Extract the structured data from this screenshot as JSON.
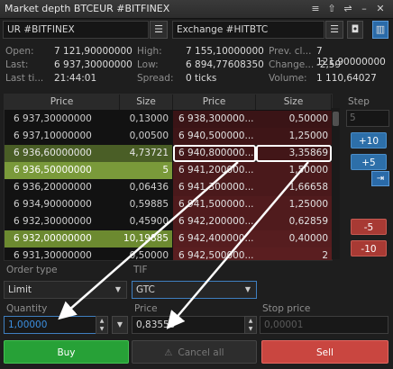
{
  "window": {
    "title": "Market depth BTCEUR  #BITFINEX",
    "buttons": [
      "≡",
      "⇧",
      "⇌",
      "–",
      "✕"
    ]
  },
  "selectors": {
    "left": {
      "value": "UR  #BITFINEX"
    },
    "right": {
      "value": "Exchange  #HITBTC"
    }
  },
  "stats": {
    "open": {
      "label": "Open:",
      "value": "7 121,90000000"
    },
    "high": {
      "label": "High:",
      "value": "7 155,10000000"
    },
    "prev": {
      "label": "Prev. cl...",
      "value": "7 121,90000000"
    },
    "last": {
      "label": "Last:",
      "value": "6 937,30000000"
    },
    "low": {
      "label": "Low:",
      "value": "6 894,77608350"
    },
    "change": {
      "label": "Change...",
      "value": "-2,59"
    },
    "lasttime": {
      "label": "Last ti...",
      "value": "21:44:01"
    },
    "spread": {
      "label": "Spread:",
      "value": "0 ticks"
    },
    "volume": {
      "label": "Volume:",
      "value": "1 110,64027"
    }
  },
  "table": {
    "headers": [
      "Price",
      "Size",
      "Price",
      "Size"
    ],
    "rows": [
      {
        "bid_price": "6 937,30000000",
        "bid_size": "0,13000",
        "ask_price": "6 938,300000...",
        "ask_size": "0,50000"
      },
      {
        "bid_price": "6 937,10000000",
        "bid_size": "0,00500",
        "ask_price": "6 940,500000...",
        "ask_size": "1,25000"
      },
      {
        "bid_price": "6 936,60000000",
        "bid_size": "4,73721",
        "ask_price": "6 940,800000...",
        "ask_size": "3,35869"
      },
      {
        "bid_price": "6 936,50000000",
        "bid_size": "5",
        "ask_price": "6 941,200000...",
        "ask_size": "1,50000"
      },
      {
        "bid_price": "6 936,20000000",
        "bid_size": "0,06436",
        "ask_price": "6 941,300000...",
        "ask_size": "1,66658"
      },
      {
        "bid_price": "6 934,90000000",
        "bid_size": "0,59885",
        "ask_price": "6 941,500000...",
        "ask_size": "1,25000"
      },
      {
        "bid_price": "6 932,30000000",
        "bid_size": "0,45900",
        "ask_price": "6 942,200000...",
        "ask_size": "0,62859"
      },
      {
        "bid_price": "6 932,00000000",
        "bid_size": "10,19885",
        "ask_price": "6 942,400000...",
        "ask_size": "0,40000"
      },
      {
        "bid_price": "6 931,30000000",
        "bid_size": "0,50000",
        "ask_price": "6 942,500000...",
        "ask_size": "2"
      }
    ]
  },
  "step": {
    "label": "Step",
    "value": "5",
    "buttons": {
      "plus10": "+10",
      "plus5": "+5",
      "minus5": "-5",
      "minus10": "-10"
    }
  },
  "order": {
    "type_label": "Order type",
    "type_value": "Limit",
    "tif_label": "TIF",
    "tif_value": "GTC",
    "quantity_label": "Quantity",
    "quantity_value": "1,00000",
    "price_label": "Price",
    "price_value": "0,83550",
    "stop_label": "Stop price",
    "stop_placeholder": "0,00001"
  },
  "actions": {
    "buy": "Buy",
    "cancel_all": "Cancel all",
    "sell": "Sell"
  },
  "colors": {
    "buy": "#27a137",
    "sell": "#c94640",
    "accent": "#2d6fa9"
  }
}
